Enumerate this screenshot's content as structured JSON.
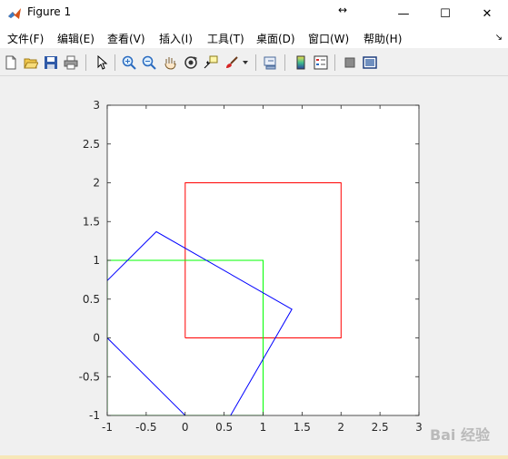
{
  "window": {
    "title": "Figure 1",
    "minimize_glyph": "—",
    "maximize_glyph": "☐",
    "close_glyph": "✕",
    "resize_glyph": "↔"
  },
  "menu": {
    "items": [
      "文件(F)",
      "编辑(E)",
      "查看(V)",
      "插入(I)",
      "工具(T)",
      "桌面(D)",
      "窗口(W)",
      "帮助(H)"
    ],
    "dock_glyph": "↘"
  },
  "toolbar": {
    "icons": [
      "new-figure-icon",
      "open-file-icon",
      "save-icon",
      "print-icon",
      "select-arrow-icon",
      "zoom-in-icon",
      "zoom-out-icon",
      "pan-hand-icon",
      "rotate-3d-icon",
      "data-cursor-icon",
      "brush-icon",
      "brush-dropdown-icon",
      "link-plot-icon",
      "colorbar-icon",
      "legend-icon",
      "hide-plot-tools-icon",
      "show-plot-tools-icon"
    ]
  },
  "chart_data": {
    "type": "line",
    "xlim": [
      -1,
      3
    ],
    "ylim": [
      -1,
      3
    ],
    "xticks": [
      "-1",
      "-0.5",
      "0",
      "0.5",
      "1",
      "1.5",
      "2",
      "2.5",
      "3"
    ],
    "yticks": [
      "-1",
      "-0.5",
      "0",
      "0.5",
      "1",
      "1.5",
      "2",
      "2.5",
      "3"
    ],
    "grid": false,
    "series": [
      {
        "color": "#ff0000",
        "x": [
          0,
          2,
          2,
          0,
          0
        ],
        "y": [
          0,
          0,
          2,
          2,
          0
        ]
      },
      {
        "color": "#00ff00",
        "x": [
          -1,
          1,
          1,
          -1,
          -1
        ],
        "y": [
          -1,
          -1,
          1,
          1,
          -1
        ]
      },
      {
        "color": "#0000ff",
        "x": [
          -1.37,
          0.37,
          1.37,
          -0.37,
          -1.37
        ],
        "y": [
          0.37,
          -1.37,
          0.37,
          1.37,
          0.37
        ]
      }
    ]
  },
  "watermark": "Bai 经验"
}
